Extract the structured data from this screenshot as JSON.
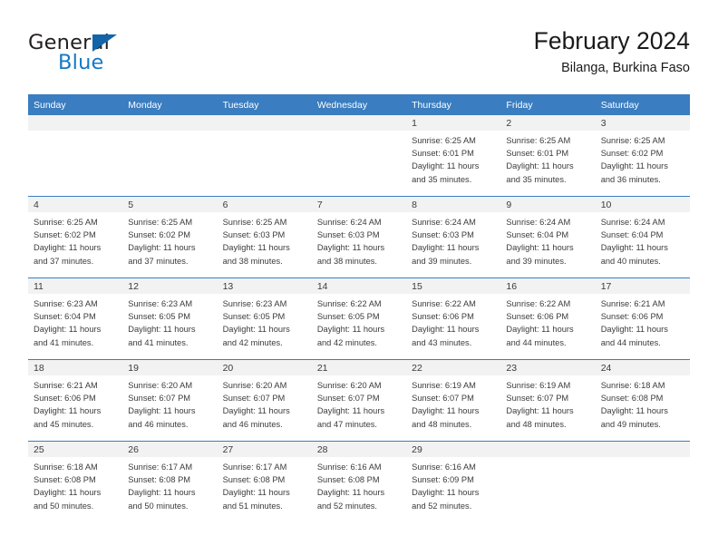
{
  "brand": {
    "name_part1": "General",
    "name_part2": "Blue",
    "triangle_icon": "blue-triangle-logo-mark",
    "color_dark": "#231f20",
    "color_blue": "#1479c4"
  },
  "header": {
    "title": "February 2024",
    "subtitle": "Bilanga, Burkina Faso"
  },
  "theme": {
    "header_blue": "#3a7dc0",
    "daynum_band": "#f2f2f2",
    "text": "#3b3b3b"
  },
  "weekdays": [
    "Sunday",
    "Monday",
    "Tuesday",
    "Wednesday",
    "Thursday",
    "Friday",
    "Saturday"
  ],
  "weeks": [
    [
      {
        "day": "",
        "lines": []
      },
      {
        "day": "",
        "lines": []
      },
      {
        "day": "",
        "lines": []
      },
      {
        "day": "",
        "lines": []
      },
      {
        "day": "1",
        "lines": [
          "Sunrise: 6:25 AM",
          "Sunset: 6:01 PM",
          "Daylight: 11 hours",
          "and 35 minutes."
        ]
      },
      {
        "day": "2",
        "lines": [
          "Sunrise: 6:25 AM",
          "Sunset: 6:01 PM",
          "Daylight: 11 hours",
          "and 35 minutes."
        ]
      },
      {
        "day": "3",
        "lines": [
          "Sunrise: 6:25 AM",
          "Sunset: 6:02 PM",
          "Daylight: 11 hours",
          "and 36 minutes."
        ]
      }
    ],
    [
      {
        "day": "4",
        "lines": [
          "Sunrise: 6:25 AM",
          "Sunset: 6:02 PM",
          "Daylight: 11 hours",
          "and 37 minutes."
        ]
      },
      {
        "day": "5",
        "lines": [
          "Sunrise: 6:25 AM",
          "Sunset: 6:02 PM",
          "Daylight: 11 hours",
          "and 37 minutes."
        ]
      },
      {
        "day": "6",
        "lines": [
          "Sunrise: 6:25 AM",
          "Sunset: 6:03 PM",
          "Daylight: 11 hours",
          "and 38 minutes."
        ]
      },
      {
        "day": "7",
        "lines": [
          "Sunrise: 6:24 AM",
          "Sunset: 6:03 PM",
          "Daylight: 11 hours",
          "and 38 minutes."
        ]
      },
      {
        "day": "8",
        "lines": [
          "Sunrise: 6:24 AM",
          "Sunset: 6:03 PM",
          "Daylight: 11 hours",
          "and 39 minutes."
        ]
      },
      {
        "day": "9",
        "lines": [
          "Sunrise: 6:24 AM",
          "Sunset: 6:04 PM",
          "Daylight: 11 hours",
          "and 39 minutes."
        ]
      },
      {
        "day": "10",
        "lines": [
          "Sunrise: 6:24 AM",
          "Sunset: 6:04 PM",
          "Daylight: 11 hours",
          "and 40 minutes."
        ]
      }
    ],
    [
      {
        "day": "11",
        "lines": [
          "Sunrise: 6:23 AM",
          "Sunset: 6:04 PM",
          "Daylight: 11 hours",
          "and 41 minutes."
        ]
      },
      {
        "day": "12",
        "lines": [
          "Sunrise: 6:23 AM",
          "Sunset: 6:05 PM",
          "Daylight: 11 hours",
          "and 41 minutes."
        ]
      },
      {
        "day": "13",
        "lines": [
          "Sunrise: 6:23 AM",
          "Sunset: 6:05 PM",
          "Daylight: 11 hours",
          "and 42 minutes."
        ]
      },
      {
        "day": "14",
        "lines": [
          "Sunrise: 6:22 AM",
          "Sunset: 6:05 PM",
          "Daylight: 11 hours",
          "and 42 minutes."
        ]
      },
      {
        "day": "15",
        "lines": [
          "Sunrise: 6:22 AM",
          "Sunset: 6:06 PM",
          "Daylight: 11 hours",
          "and 43 minutes."
        ]
      },
      {
        "day": "16",
        "lines": [
          "Sunrise: 6:22 AM",
          "Sunset: 6:06 PM",
          "Daylight: 11 hours",
          "and 44 minutes."
        ]
      },
      {
        "day": "17",
        "lines": [
          "Sunrise: 6:21 AM",
          "Sunset: 6:06 PM",
          "Daylight: 11 hours",
          "and 44 minutes."
        ]
      }
    ],
    [
      {
        "day": "18",
        "lines": [
          "Sunrise: 6:21 AM",
          "Sunset: 6:06 PM",
          "Daylight: 11 hours",
          "and 45 minutes."
        ]
      },
      {
        "day": "19",
        "lines": [
          "Sunrise: 6:20 AM",
          "Sunset: 6:07 PM",
          "Daylight: 11 hours",
          "and 46 minutes."
        ]
      },
      {
        "day": "20",
        "lines": [
          "Sunrise: 6:20 AM",
          "Sunset: 6:07 PM",
          "Daylight: 11 hours",
          "and 46 minutes."
        ]
      },
      {
        "day": "21",
        "lines": [
          "Sunrise: 6:20 AM",
          "Sunset: 6:07 PM",
          "Daylight: 11 hours",
          "and 47 minutes."
        ]
      },
      {
        "day": "22",
        "lines": [
          "Sunrise: 6:19 AM",
          "Sunset: 6:07 PM",
          "Daylight: 11 hours",
          "and 48 minutes."
        ]
      },
      {
        "day": "23",
        "lines": [
          "Sunrise: 6:19 AM",
          "Sunset: 6:07 PM",
          "Daylight: 11 hours",
          "and 48 minutes."
        ]
      },
      {
        "day": "24",
        "lines": [
          "Sunrise: 6:18 AM",
          "Sunset: 6:08 PM",
          "Daylight: 11 hours",
          "and 49 minutes."
        ]
      }
    ],
    [
      {
        "day": "25",
        "lines": [
          "Sunrise: 6:18 AM",
          "Sunset: 6:08 PM",
          "Daylight: 11 hours",
          "and 50 minutes."
        ]
      },
      {
        "day": "26",
        "lines": [
          "Sunrise: 6:17 AM",
          "Sunset: 6:08 PM",
          "Daylight: 11 hours",
          "and 50 minutes."
        ]
      },
      {
        "day": "27",
        "lines": [
          "Sunrise: 6:17 AM",
          "Sunset: 6:08 PM",
          "Daylight: 11 hours",
          "and 51 minutes."
        ]
      },
      {
        "day": "28",
        "lines": [
          "Sunrise: 6:16 AM",
          "Sunset: 6:08 PM",
          "Daylight: 11 hours",
          "and 52 minutes."
        ]
      },
      {
        "day": "29",
        "lines": [
          "Sunrise: 6:16 AM",
          "Sunset: 6:09 PM",
          "Daylight: 11 hours",
          "and 52 minutes."
        ]
      },
      {
        "day": "",
        "lines": []
      },
      {
        "day": "",
        "lines": []
      }
    ]
  ]
}
